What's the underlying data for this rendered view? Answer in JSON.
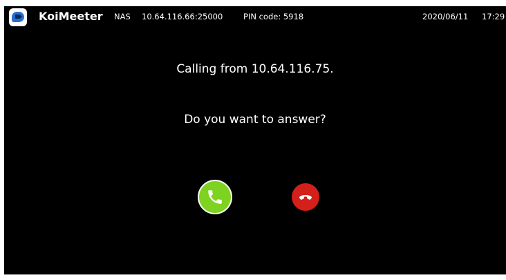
{
  "header": {
    "app_name": "KoiMeeter",
    "nas_label": "NAS",
    "nas_address": "10.64.116.66:25000",
    "pin_code": "PIN code: 5918",
    "date": "2020/06/11",
    "time": "17:29"
  },
  "call": {
    "caller_message": "Calling from 10.64.116.75.",
    "question": "Do you want to answer?",
    "answer_icon": "phone-answer-icon",
    "decline_icon": "phone-hangup-icon"
  },
  "colors": {
    "background": "#000000",
    "text": "#ffffff",
    "answer": "#7ed321",
    "decline": "#d3201a",
    "logo_blue": "#2a6fd0"
  }
}
